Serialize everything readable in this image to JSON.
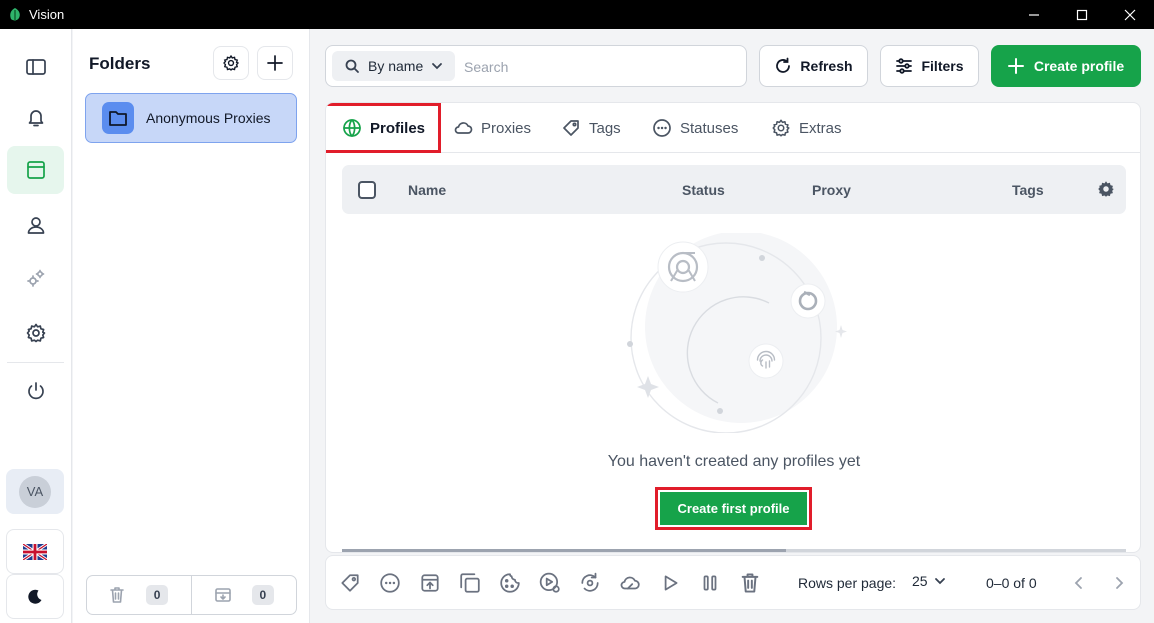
{
  "window": {
    "title": "Vision"
  },
  "folders": {
    "title": "Folders",
    "items": [
      {
        "label": "Anonymous Proxies"
      }
    ],
    "trash_count": "0",
    "archive_count": "0"
  },
  "user": {
    "initials": "VA"
  },
  "toolbar": {
    "sort_label": "By name",
    "search_placeholder": "Search",
    "refresh_label": "Refresh",
    "filters_label": "Filters",
    "create_label": "Create profile"
  },
  "tabs": [
    {
      "label": "Profiles",
      "icon": "globe-icon",
      "active": true
    },
    {
      "label": "Proxies",
      "icon": "cloud-icon"
    },
    {
      "label": "Tags",
      "icon": "tag-icon"
    },
    {
      "label": "Statuses",
      "icon": "dots-circle-icon"
    },
    {
      "label": "Extras",
      "icon": "gear-icon"
    }
  ],
  "table": {
    "columns": [
      "Name",
      "Status",
      "Proxy",
      "Tags"
    ]
  },
  "empty": {
    "message": "You haven't created any profiles yet",
    "button_label": "Create first profile"
  },
  "pagination": {
    "rows_label": "Rows per page:",
    "rows_value": "25",
    "range": "0–0 of 0"
  },
  "colors": {
    "accent": "#16a34a",
    "highlight": "#e11d2a",
    "folder_bg": "#c7d7f8"
  }
}
